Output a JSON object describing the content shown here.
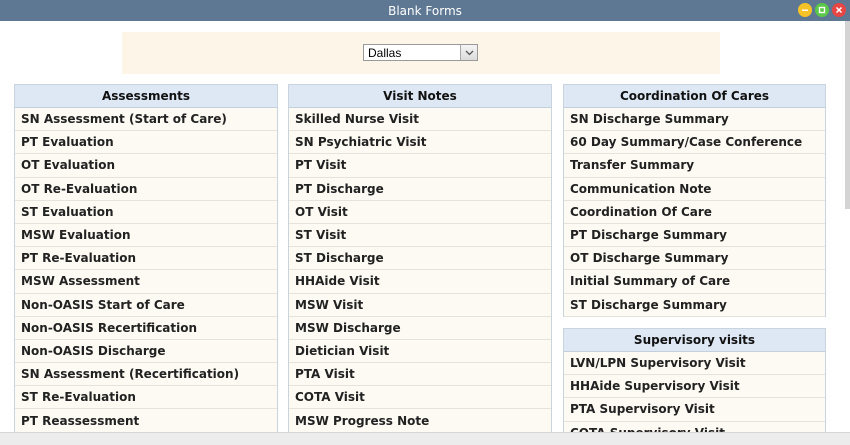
{
  "window": {
    "title": "Blank Forms",
    "buttons": [
      {
        "name": "minimize",
        "color": "#f5c228"
      },
      {
        "name": "maximize",
        "color": "#5cc84a"
      },
      {
        "name": "close",
        "color": "#e84545"
      }
    ]
  },
  "filter": {
    "location": "Dallas"
  },
  "assessments": {
    "title": "Assessments",
    "items": [
      "SN Assessment (Start of Care)",
      "PT Evaluation",
      "OT Evaluation",
      "OT Re-Evaluation",
      "ST Evaluation",
      "MSW Evaluation",
      "PT Re-Evaluation",
      "MSW Assessment",
      "Non-OASIS Start of Care",
      "Non-OASIS Recertification",
      "Non-OASIS Discharge",
      "SN Assessment (Recertification)",
      "ST Re-Evaluation",
      "PT Reassessment"
    ]
  },
  "visit_notes": {
    "title": "Visit Notes",
    "items": [
      "Skilled Nurse Visit",
      "SN Psychiatric Visit",
      "PT Visit",
      "PT Discharge",
      "OT Visit",
      "ST Visit",
      "ST Discharge",
      "HHAide Visit",
      "MSW Visit",
      "MSW Discharge",
      "Dietician Visit",
      "PTA Visit",
      "COTA Visit",
      "MSW Progress Note"
    ]
  },
  "coordination": {
    "title": "Coordination Of Cares",
    "items": [
      "SN Discharge Summary",
      "60 Day Summary/Case Conference",
      "Transfer Summary",
      "Communication Note",
      "Coordination Of Care",
      "PT Discharge Summary",
      "OT Discharge Summary",
      "Initial Summary of Care",
      "ST Discharge Summary"
    ]
  },
  "supervisory": {
    "title": "Supervisory visits",
    "items": [
      "LVN/LPN Supervisory Visit",
      "HHAide Supervisory Visit",
      "PTA Supervisory Visit",
      "COTA Supervisory Visit"
    ]
  }
}
